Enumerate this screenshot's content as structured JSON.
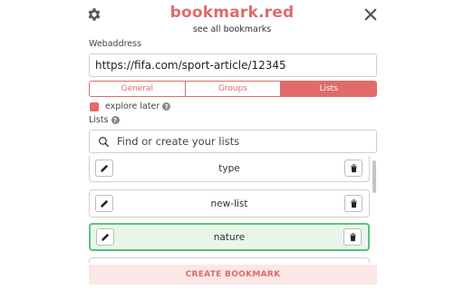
{
  "header": {
    "brand": "bookmark.red",
    "see_all": "see all bookmarks",
    "settings_icon": "gear-icon",
    "close_icon": "close-icon"
  },
  "form": {
    "web_label": "Webaddress",
    "url_value": "https://fifa.com/sport-article/12345",
    "tabs": [
      {
        "label": "General",
        "active": false
      },
      {
        "label": "Groups",
        "active": false
      },
      {
        "label": "Lists",
        "active": true
      }
    ],
    "explore_label": "explore later",
    "explore_checked": true,
    "lists_label": "Lists",
    "search_placeholder": "Find or create your lists"
  },
  "lists": {
    "items": [
      {
        "name": "type",
        "selected": false
      },
      {
        "name": "new-list",
        "selected": false
      },
      {
        "name": "nature",
        "selected": true
      }
    ]
  },
  "footer": {
    "create_label": "CREATE BOOKMARK"
  },
  "colors": {
    "brand": "#e06b68",
    "selected_border": "#5cc07a",
    "selected_bg": "#e8f6ea"
  }
}
